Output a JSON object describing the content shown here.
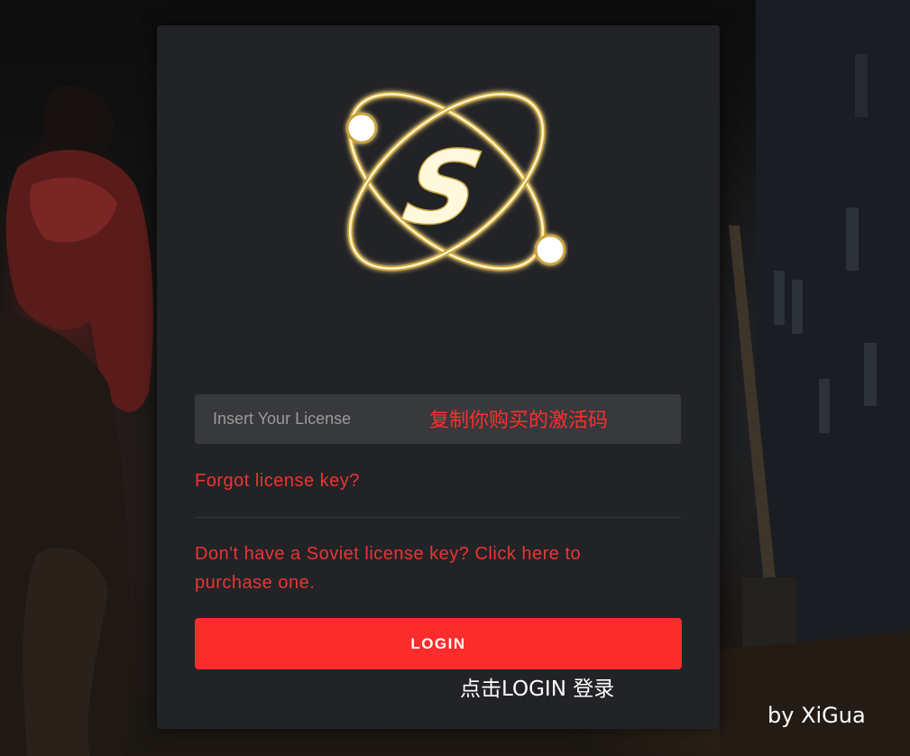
{
  "login": {
    "license_placeholder": "Insert Your License",
    "license_value": "",
    "forgot_link": "Forgot license key?",
    "purchase_link": "Don't have a Soviet license key? Click here to purchase one.",
    "login_button": "LOGIN"
  },
  "annotations": {
    "copy_hint": "复制你购买的激活码",
    "login_hint": "点击LOGIN 登录",
    "credit": "by XiGua"
  },
  "logo": {
    "letter": "S",
    "icon": "atom-logo-icon"
  },
  "colors": {
    "card_background": "#222326",
    "input_background": "#38393c",
    "accent_red": "#fd2c2c",
    "link_red": "#ec3434",
    "logo_ring": "#f2e0a0",
    "logo_glow": "#c9a23a"
  }
}
